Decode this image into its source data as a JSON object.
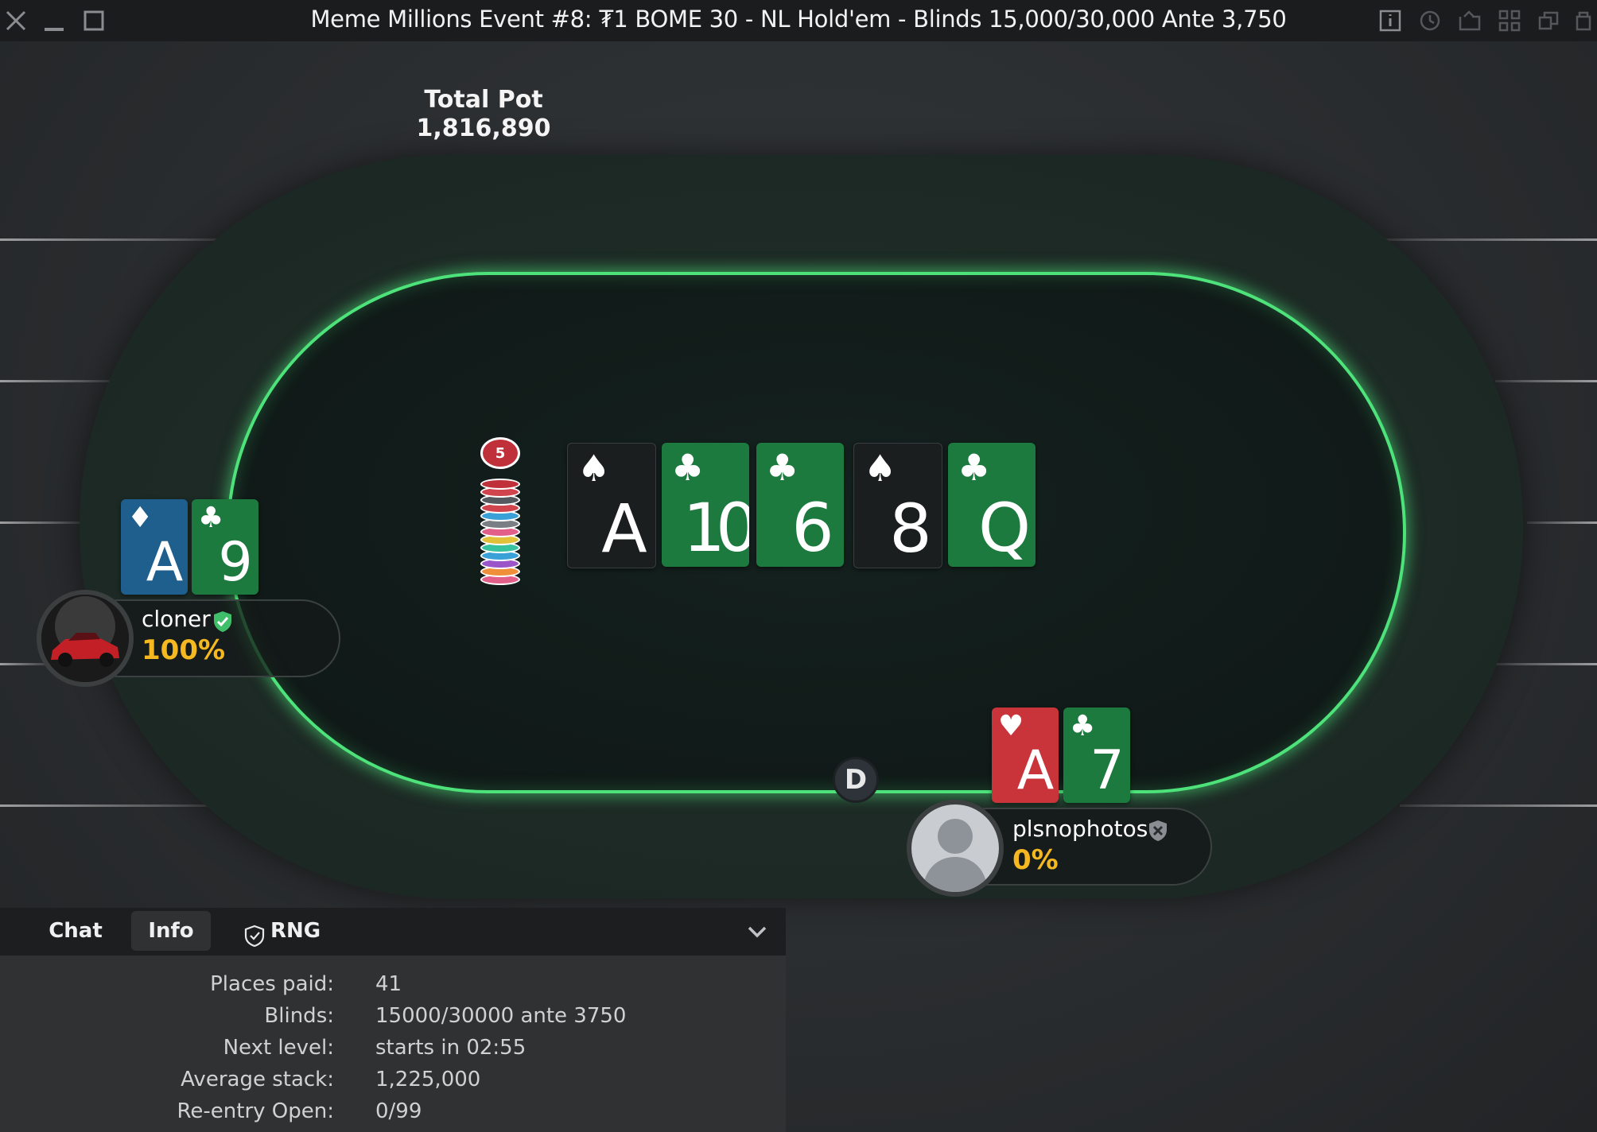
{
  "window": {
    "title": "Meme Millions Event #8: ₮1 BOME 30 - NL Hold'em - Blinds 15,000/30,000 Ante 3,750"
  },
  "pot": {
    "label": "Total Pot",
    "amount": "1,816,890"
  },
  "chip_stack": {
    "top_chip_value": "5"
  },
  "board": [
    {
      "rank": "A",
      "suit": "♠",
      "suit_name": "spades",
      "color": "#1b1e1f"
    },
    {
      "rank": "10",
      "suit": "♣",
      "suit_name": "clubs",
      "color": "#1c7a3e"
    },
    {
      "rank": "6",
      "suit": "♣",
      "suit_name": "clubs",
      "color": "#1c7a3e"
    },
    {
      "rank": "8",
      "suit": "♠",
      "suit_name": "spades",
      "color": "#1b1e1f"
    },
    {
      "rank": "Q",
      "suit": "♣",
      "suit_name": "clubs",
      "color": "#1c7a3e"
    }
  ],
  "players": [
    {
      "name": "cloner",
      "equity": "100%",
      "verified": true,
      "cards": [
        {
          "rank": "A",
          "suit": "♦",
          "suit_name": "diamonds"
        },
        {
          "rank": "9",
          "suit": "♣",
          "suit_name": "clubs"
        }
      ]
    },
    {
      "name": "plsnophotos",
      "equity": "0%",
      "verified": false,
      "cards": [
        {
          "rank": "A",
          "suit": "♥",
          "suit_name": "hearts"
        },
        {
          "rank": "7",
          "suit": "♣",
          "suit_name": "clubs"
        }
      ]
    }
  ],
  "dealer_button": "D",
  "panel": {
    "tabs": [
      {
        "label": "Chat",
        "active": false
      },
      {
        "label": "Info",
        "active": true
      },
      {
        "label": "RNG",
        "active": false
      }
    ],
    "info": [
      {
        "key": "Places paid:",
        "value": "41"
      },
      {
        "key": "Blinds:",
        "value": "15000/30000 ante 3750"
      },
      {
        "key": "Next level:",
        "value": "starts in 02:55"
      },
      {
        "key": "Average stack:",
        "value": "1,225,000"
      },
      {
        "key": "Re-entry Open:",
        "value": "0/99"
      }
    ]
  },
  "colors": {
    "accent_green": "#4de37a",
    "equity_yellow": "#f5b820",
    "verified_green": "#3fbf6a"
  }
}
